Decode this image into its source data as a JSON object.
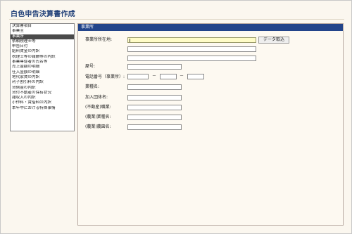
{
  "app": {
    "title": "白色申告決算書作成"
  },
  "sidebar": {
    "items": [
      {
        "label": "決算書項目",
        "selected": false
      },
      {
        "label": "事業主",
        "selected": false
      },
      {
        "label": "事業所",
        "selected": true
      },
      {
        "label": "依頼税理士等",
        "selected": false
      },
      {
        "label": "申告日付",
        "selected": false
      },
      {
        "label": "給料賃金の内訳",
        "selected": false
      },
      {
        "label": "税理士等の報酬等の内訳",
        "selected": false
      },
      {
        "label": "事業専従者の氏名等",
        "selected": false
      },
      {
        "label": "売上金額の明細",
        "selected": false
      },
      {
        "label": "仕入金額の明細",
        "selected": false
      },
      {
        "label": "地代家賃の内訳",
        "selected": false
      },
      {
        "label": "利子割引料の内訳",
        "selected": false
      },
      {
        "label": "貸倒金の内訳",
        "selected": false
      },
      {
        "label": "貸付不動産の保有状況",
        "selected": false
      },
      {
        "label": "雑収入の内訳",
        "selected": false
      },
      {
        "label": "小作料・賃借料の内訳",
        "selected": false
      },
      {
        "label": "本年中における特殊事情",
        "selected": false
      }
    ]
  },
  "panel": {
    "header": "事業所",
    "address_label": "事業所所在地:",
    "fetch_button": "データ取込",
    "yago_label": "屋号:",
    "phone_label": "電話番号（事業所）:",
    "phone_sep": "－",
    "industry_label": "業種名:",
    "assoc_label": "加入団体名:",
    "realestate_label": "(不動産)職業:",
    "farm_industry_label": "(農業)業種名:",
    "farm_name_label": "(農業)農園名:"
  }
}
